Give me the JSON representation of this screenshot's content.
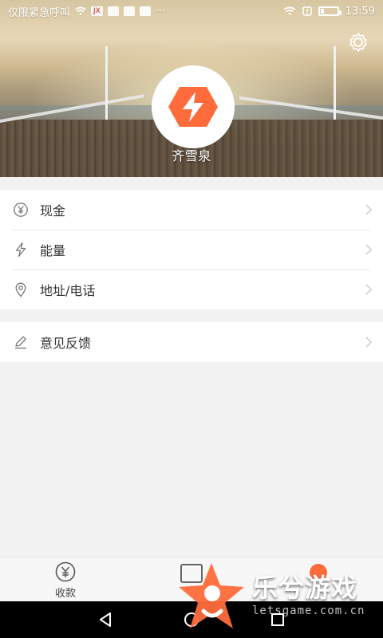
{
  "status_bar": {
    "left_text": "仅限紧急呼叫",
    "extra": "···",
    "time": "13:59",
    "battery_level": 0.2
  },
  "profile": {
    "name": "齐雪泉"
  },
  "menu": {
    "section1": [
      {
        "label": "现金",
        "icon": "yen-circle-icon"
      },
      {
        "label": "能量",
        "icon": "lightning-icon"
      },
      {
        "label": "地址/电话",
        "icon": "location-pin-icon"
      }
    ],
    "section2": [
      {
        "label": "意见反馈",
        "icon": "pencil-icon"
      }
    ]
  },
  "tabs": {
    "receive_label": "收款"
  },
  "watermark": {
    "title": "乐兮游戏",
    "subtitle": "letsgame.com.cn"
  },
  "colors": {
    "accent": "#ff6b3a",
    "list_bg": "#ffffff",
    "page_bg": "#f2f2f2"
  }
}
